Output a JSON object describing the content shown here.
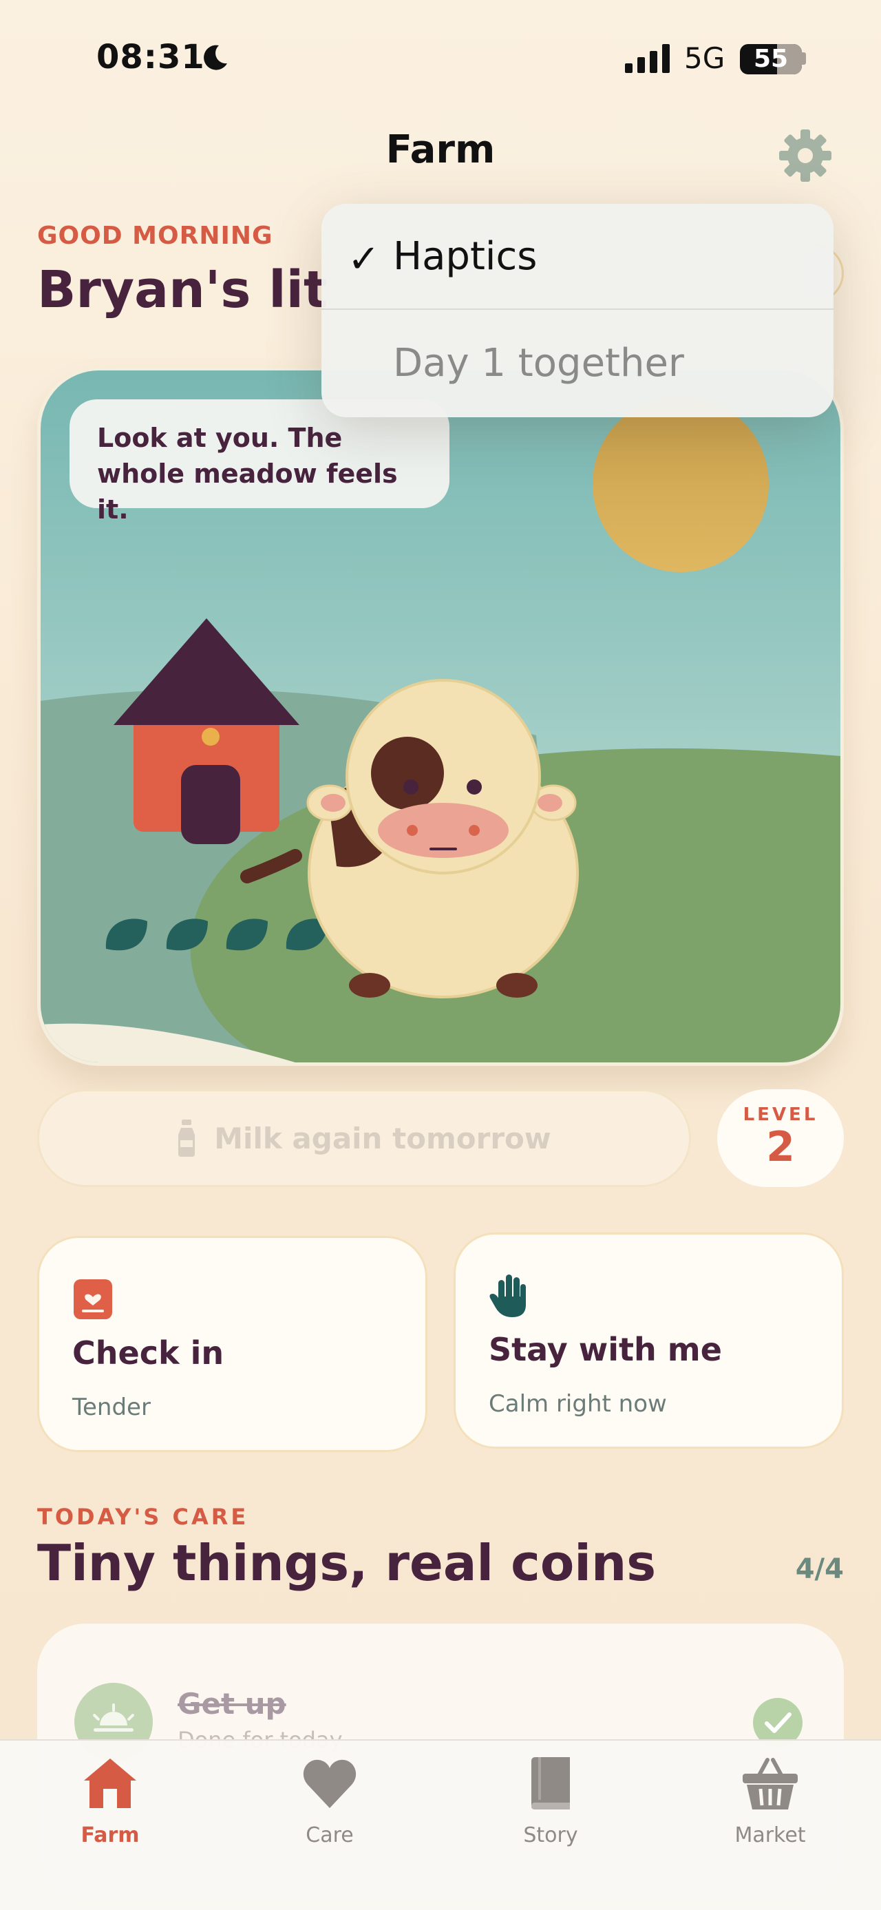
{
  "status_bar": {
    "time": "08:31",
    "network": "5G",
    "battery": "55"
  },
  "nav": {
    "title": "Farm"
  },
  "greeting": {
    "eyebrow": "GOOD MORNING",
    "headline": "Bryan's litt"
  },
  "scene": {
    "speech": "Look at you. The whole meadow feels it."
  },
  "milk": {
    "label": "Milk again tomorrow"
  },
  "level": {
    "label": "LEVEL",
    "value": "2"
  },
  "cards": [
    {
      "title": "Check in",
      "subtitle": "Tender"
    },
    {
      "title": "Stay with me",
      "subtitle": "Calm right now"
    }
  ],
  "care": {
    "eyebrow": "TODAY'S CARE",
    "title": "Tiny things, real coins",
    "count": "4/4",
    "tasks": [
      {
        "title": "Get up",
        "subtitle": "Done for today",
        "done": true
      }
    ]
  },
  "tabs": [
    {
      "label": "Farm",
      "icon": "house-icon",
      "active": true
    },
    {
      "label": "Care",
      "icon": "heart-icon",
      "active": false
    },
    {
      "label": "Story",
      "icon": "book-icon",
      "active": false
    },
    {
      "label": "Market",
      "icon": "basket-icon",
      "active": false
    }
  ],
  "menu": {
    "items": [
      {
        "label": "Haptics",
        "checked": true,
        "check_glyph": "✓"
      },
      {
        "label": "Day 1 together",
        "checked": false
      }
    ]
  },
  "colors": {
    "accent": "#d65b44",
    "ink": "#47233e",
    "meadow": "#7da36b",
    "sky": "#86c1bb"
  }
}
